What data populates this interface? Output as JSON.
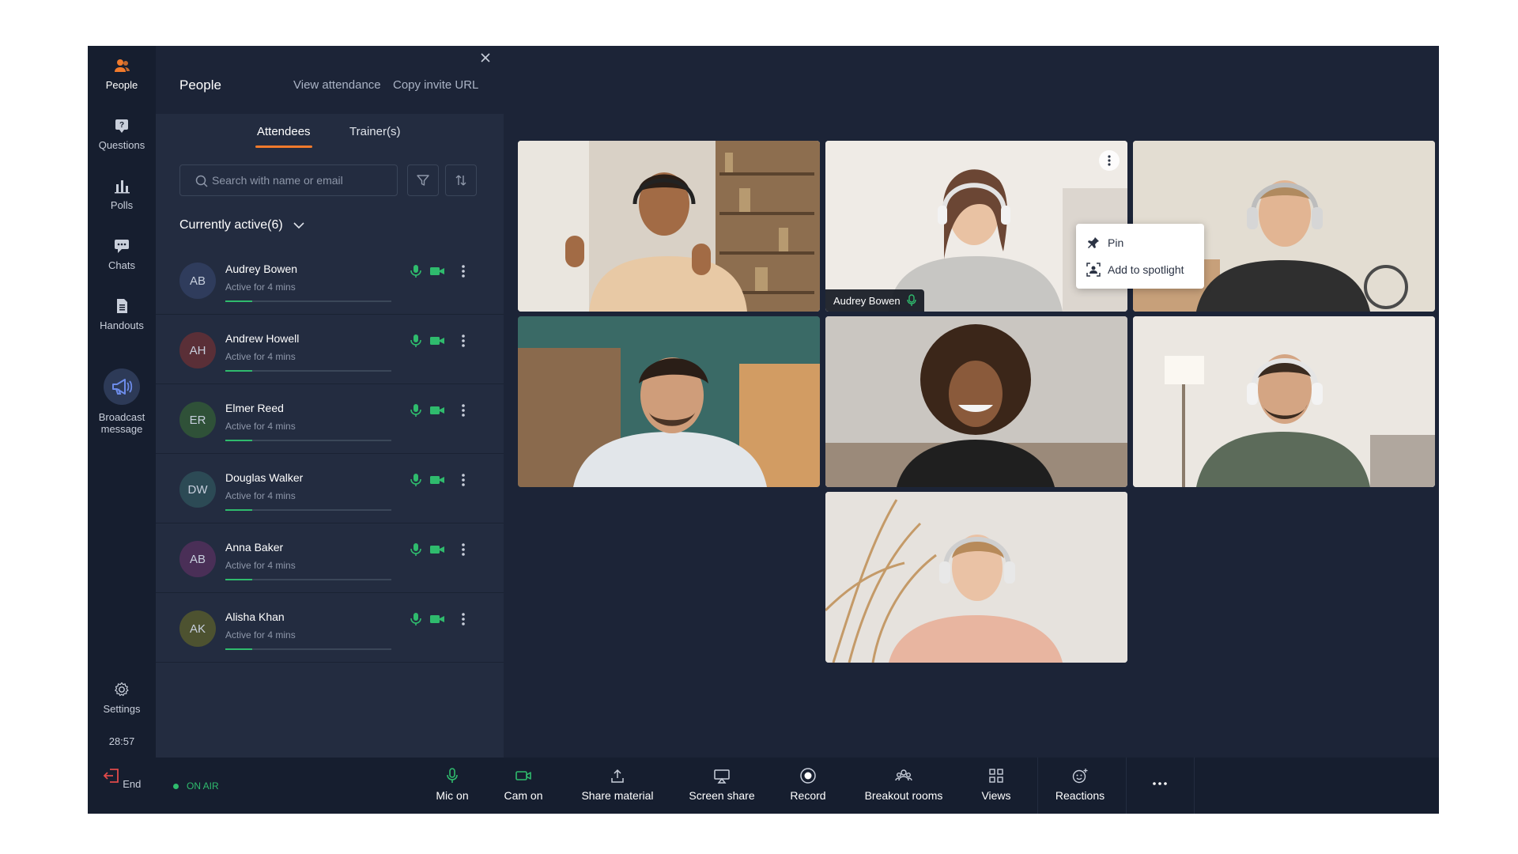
{
  "rail": {
    "people": "People",
    "questions": "Questions",
    "polls": "Polls",
    "chats": "Chats",
    "handouts": "Handouts",
    "broadcast_line1": "Broadcast",
    "broadcast_line2": "message",
    "settings": "Settings",
    "timer": "28:57"
  },
  "panel": {
    "title": "People",
    "view_attendance": "View attendance",
    "copy_invite": "Copy invite URL",
    "tabs": [
      "Attendees",
      "Trainer(s)"
    ],
    "search_placeholder": "Search with name or email",
    "active_header": "Currently active(6)",
    "attendees": [
      {
        "initials": "AB",
        "name": "Audrey Bowen",
        "status": "Active for 4 mins",
        "avatar_bg": "#2f3c5c"
      },
      {
        "initials": "AH",
        "name": "Andrew Howell",
        "status": "Active for 4 mins",
        "avatar_bg": "#5a2f37"
      },
      {
        "initials": "ER",
        "name": "Elmer Reed",
        "status": "Active for 4 mins",
        "avatar_bg": "#2f5138"
      },
      {
        "initials": "DW",
        "name": "Douglas Walker",
        "status": "Active for 4 mins",
        "avatar_bg": "#2c4a55"
      },
      {
        "initials": "AB",
        "name": "Anna Baker",
        "status": "Active for 4 mins",
        "avatar_bg": "#4a2f57"
      },
      {
        "initials": "AK",
        "name": "Alisha Khan",
        "status": "Active for 4 mins",
        "avatar_bg": "#4d5230"
      }
    ]
  },
  "video": {
    "name_tag": "Audrey Bowen",
    "menu": {
      "pin": "Pin",
      "spotlight": "Add to spotlight"
    }
  },
  "bottombar": {
    "end": "End",
    "onair": "ON AIR",
    "buttons": [
      "Mic on",
      "Cam on",
      "Share material",
      "Screen share",
      "Record",
      "Breakout rooms",
      "Views",
      "Reactions"
    ]
  },
  "colors": {
    "accent": "#f07a2c",
    "active_green": "#2fbb6d",
    "end_red": "#e04a4a"
  }
}
